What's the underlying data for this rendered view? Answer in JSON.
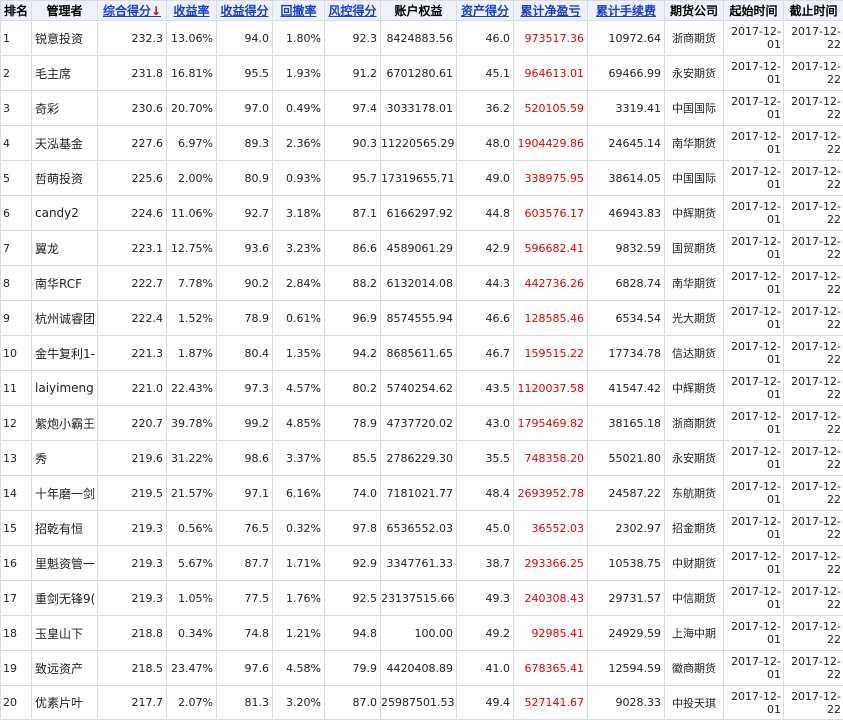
{
  "headers": [
    {
      "label": "排名",
      "link": false,
      "arrow": ""
    },
    {
      "label": "管理者",
      "link": false,
      "arrow": ""
    },
    {
      "label": "综合得分",
      "link": true,
      "arrow": "↓"
    },
    {
      "label": "收益率",
      "link": true,
      "arrow": ""
    },
    {
      "label": "收益得分",
      "link": true,
      "arrow": ""
    },
    {
      "label": "回撤率",
      "link": true,
      "arrow": ""
    },
    {
      "label": "风控得分",
      "link": true,
      "arrow": ""
    },
    {
      "label": "账户权益",
      "link": false,
      "arrow": ""
    },
    {
      "label": "资产得分",
      "link": true,
      "arrow": ""
    },
    {
      "label": "累计净盈亏",
      "link": true,
      "arrow": ""
    },
    {
      "label": "累计手续费",
      "link": true,
      "arrow": ""
    },
    {
      "label": "期货公司",
      "link": false,
      "arrow": ""
    },
    {
      "label": "起始时间",
      "link": false,
      "arrow": ""
    },
    {
      "label": "截止时间",
      "link": false,
      "arrow": ""
    }
  ],
  "rows": [
    {
      "rank": "1",
      "manager": "锐意投资",
      "score": "232.3",
      "return_rate": "13.06%",
      "return_score": "94.0",
      "drawdown": "1.80%",
      "risk_score": "92.3",
      "equity": "8424883.56",
      "asset_score": "46.0",
      "net_pnl": "973517.36",
      "fees": "10972.64",
      "company": "浙商期货",
      "start_y": "2017-12-",
      "start_d": "01",
      "end_y": "2017-12-",
      "end_d": "22"
    },
    {
      "rank": "2",
      "manager": "毛主席",
      "score": "231.8",
      "return_rate": "16.81%",
      "return_score": "95.5",
      "drawdown": "1.93%",
      "risk_score": "91.2",
      "equity": "6701280.61",
      "asset_score": "45.1",
      "net_pnl": "964613.01",
      "fees": "69466.99",
      "company": "永安期货",
      "start_y": "2017-12-",
      "start_d": "01",
      "end_y": "2017-12-",
      "end_d": "22"
    },
    {
      "rank": "3",
      "manager": "奇彩",
      "score": "230.6",
      "return_rate": "20.70%",
      "return_score": "97.0",
      "drawdown": "0.49%",
      "risk_score": "97.4",
      "equity": "3033178.01",
      "asset_score": "36.2",
      "net_pnl": "520105.59",
      "fees": "3319.41",
      "company": "中国国际",
      "start_y": "2017-12-",
      "start_d": "01",
      "end_y": "2017-12-",
      "end_d": "22"
    },
    {
      "rank": "4",
      "manager": "天泓基金",
      "score": "227.6",
      "return_rate": "6.97%",
      "return_score": "89.3",
      "drawdown": "2.36%",
      "risk_score": "90.3",
      "equity": "11220565.29",
      "asset_score": "48.0",
      "net_pnl": "1904429.86",
      "fees": "24645.14",
      "company": "南华期货",
      "start_y": "2017-12-",
      "start_d": "01",
      "end_y": "2017-12-",
      "end_d": "22"
    },
    {
      "rank": "5",
      "manager": "哲萌投资",
      "score": "225.6",
      "return_rate": "2.00%",
      "return_score": "80.9",
      "drawdown": "0.93%",
      "risk_score": "95.7",
      "equity": "17319655.71",
      "asset_score": "49.0",
      "net_pnl": "338975.95",
      "fees": "38614.05",
      "company": "中国国际",
      "start_y": "2017-12-",
      "start_d": "01",
      "end_y": "2017-12-",
      "end_d": "22"
    },
    {
      "rank": "6",
      "manager": "candy2",
      "score": "224.6",
      "return_rate": "11.06%",
      "return_score": "92.7",
      "drawdown": "3.18%",
      "risk_score": "87.1",
      "equity": "6166297.92",
      "asset_score": "44.8",
      "net_pnl": "603576.17",
      "fees": "46943.83",
      "company": "中辉期货",
      "start_y": "2017-12-",
      "start_d": "01",
      "end_y": "2017-12-",
      "end_d": "22"
    },
    {
      "rank": "7",
      "manager": "翼龙",
      "score": "223.1",
      "return_rate": "12.75%",
      "return_score": "93.6",
      "drawdown": "3.23%",
      "risk_score": "86.6",
      "equity": "4589061.29",
      "asset_score": "42.9",
      "net_pnl": "596682.41",
      "fees": "9832.59",
      "company": "国贸期货",
      "start_y": "2017-12-",
      "start_d": "01",
      "end_y": "2017-12-",
      "end_d": "22"
    },
    {
      "rank": "8",
      "manager": "南华RCF",
      "score": "222.7",
      "return_rate": "7.78%",
      "return_score": "90.2",
      "drawdown": "2.84%",
      "risk_score": "88.2",
      "equity": "6132014.08",
      "asset_score": "44.3",
      "net_pnl": "442736.26",
      "fees": "6828.74",
      "company": "南华期货",
      "start_y": "2017-12-",
      "start_d": "01",
      "end_y": "2017-12-",
      "end_d": "22"
    },
    {
      "rank": "9",
      "manager": "杭州诚睿团",
      "score": "222.4",
      "return_rate": "1.52%",
      "return_score": "78.9",
      "drawdown": "0.61%",
      "risk_score": "96.9",
      "equity": "8574555.94",
      "asset_score": "46.6",
      "net_pnl": "128585.46",
      "fees": "6534.54",
      "company": "光大期货",
      "start_y": "2017-12-",
      "start_d": "01",
      "end_y": "2017-12-",
      "end_d": "22"
    },
    {
      "rank": "10",
      "manager": "金牛复利1-",
      "score": "221.3",
      "return_rate": "1.87%",
      "return_score": "80.4",
      "drawdown": "1.35%",
      "risk_score": "94.2",
      "equity": "8685611.65",
      "asset_score": "46.7",
      "net_pnl": "159515.22",
      "fees": "17734.78",
      "company": "信达期货",
      "start_y": "2017-12-",
      "start_d": "01",
      "end_y": "2017-12-",
      "end_d": "22"
    },
    {
      "rank": "11",
      "manager": "laiyimeng",
      "score": "221.0",
      "return_rate": "22.43%",
      "return_score": "97.3",
      "drawdown": "4.57%",
      "risk_score": "80.2",
      "equity": "5740254.62",
      "asset_score": "43.5",
      "net_pnl": "1120037.58",
      "fees": "41547.42",
      "company": "中辉期货",
      "start_y": "2017-12-",
      "start_d": "01",
      "end_y": "2017-12-",
      "end_d": "22"
    },
    {
      "rank": "12",
      "manager": "紫炮小霸王",
      "score": "220.7",
      "return_rate": "39.78%",
      "return_score": "99.2",
      "drawdown": "4.85%",
      "risk_score": "78.9",
      "equity": "4737720.02",
      "asset_score": "43.0",
      "net_pnl": "1795469.82",
      "fees": "38165.18",
      "company": "浙商期货",
      "start_y": "2017-12-",
      "start_d": "01",
      "end_y": "2017-12-",
      "end_d": "22"
    },
    {
      "rank": "13",
      "manager": "秀",
      "score": "219.6",
      "return_rate": "31.22%",
      "return_score": "98.6",
      "drawdown": "3.37%",
      "risk_score": "85.5",
      "equity": "2786229.30",
      "asset_score": "35.5",
      "net_pnl": "748358.20",
      "fees": "55021.80",
      "company": "永安期货",
      "start_y": "2017-12-",
      "start_d": "01",
      "end_y": "2017-12-",
      "end_d": "22"
    },
    {
      "rank": "14",
      "manager": "十年磨一剑",
      "score": "219.5",
      "return_rate": "21.57%",
      "return_score": "97.1",
      "drawdown": "6.16%",
      "risk_score": "74.0",
      "equity": "7181021.77",
      "asset_score": "48.4",
      "net_pnl": "2693952.78",
      "fees": "24587.22",
      "company": "东航期货",
      "start_y": "2017-12-",
      "start_d": "01",
      "end_y": "2017-12-",
      "end_d": "22"
    },
    {
      "rank": "15",
      "manager": "招乾有恒",
      "score": "219.3",
      "return_rate": "0.56%",
      "return_score": "76.5",
      "drawdown": "0.32%",
      "risk_score": "97.8",
      "equity": "6536552.03",
      "asset_score": "45.0",
      "net_pnl": "36552.03",
      "fees": "2302.97",
      "company": "招金期货",
      "start_y": "2017-12-",
      "start_d": "01",
      "end_y": "2017-12-",
      "end_d": "22"
    },
    {
      "rank": "16",
      "manager": "里魁资管一",
      "score": "219.3",
      "return_rate": "5.67%",
      "return_score": "87.7",
      "drawdown": "1.71%",
      "risk_score": "92.9",
      "equity": "3347761.33",
      "asset_score": "38.7",
      "net_pnl": "293366.25",
      "fees": "10538.75",
      "company": "中财期货",
      "start_y": "2017-12-",
      "start_d": "01",
      "end_y": "2017-12-",
      "end_d": "22"
    },
    {
      "rank": "17",
      "manager": "重剑无锋9(",
      "score": "219.3",
      "return_rate": "1.05%",
      "return_score": "77.5",
      "drawdown": "1.76%",
      "risk_score": "92.5",
      "equity": "23137515.66",
      "asset_score": "49.3",
      "net_pnl": "240308.43",
      "fees": "29731.57",
      "company": "中信期货",
      "start_y": "2017-12-",
      "start_d": "01",
      "end_y": "2017-12-",
      "end_d": "22"
    },
    {
      "rank": "18",
      "manager": "玉皇山下",
      "score": "218.8",
      "return_rate": "0.34%",
      "return_score": "74.8",
      "drawdown": "1.21%",
      "risk_score": "94.8",
      "equity": "100.00",
      "asset_score": "49.2",
      "net_pnl": "92985.41",
      "fees": "24929.59",
      "company": "上海中期",
      "start_y": "2017-12-",
      "start_d": "01",
      "end_y": "2017-12-",
      "end_d": "22"
    },
    {
      "rank": "19",
      "manager": "致远资产",
      "score": "218.5",
      "return_rate": "23.47%",
      "return_score": "97.6",
      "drawdown": "4.58%",
      "risk_score": "79.9",
      "equity": "4420408.89",
      "asset_score": "41.0",
      "net_pnl": "678365.41",
      "fees": "12594.59",
      "company": "徽商期货",
      "start_y": "2017-12-",
      "start_d": "01",
      "end_y": "2017-12-",
      "end_d": "22"
    },
    {
      "rank": "20",
      "manager": "优素片叶",
      "score": "217.7",
      "return_rate": "2.07%",
      "return_score": "81.3",
      "drawdown": "3.20%",
      "risk_score": "87.0",
      "equity": "25987501.53",
      "asset_score": "49.4",
      "net_pnl": "527141.67",
      "fees": "9028.33",
      "company": "中投天琪",
      "start_y": "2017-12-",
      "start_d": "01",
      "end_y": "2017-12-",
      "end_d": "22"
    }
  ],
  "colors": {
    "header_link": "#1a3fd0",
    "sort_arrow": "#d00000",
    "net_pnl": "#e00000",
    "header_bg": "#eef2f8",
    "border": "#d6dde8"
  }
}
